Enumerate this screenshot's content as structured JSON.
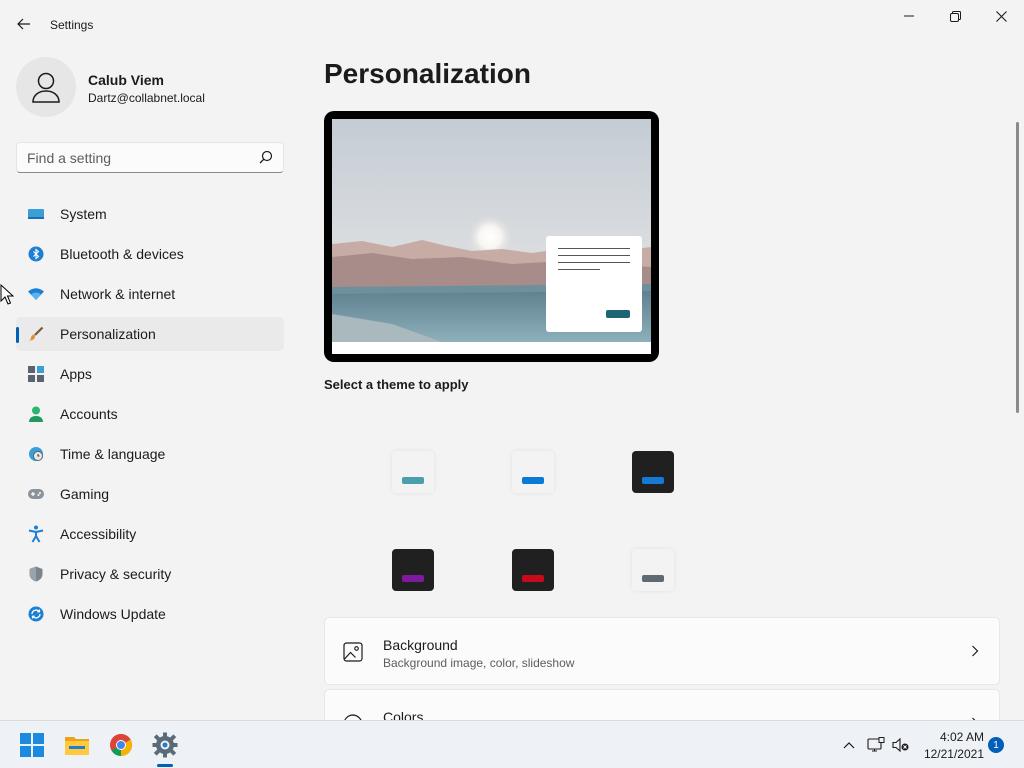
{
  "window": {
    "title": "Settings"
  },
  "user": {
    "name": "Calub Viem",
    "email": "Dartz@collabnet.local"
  },
  "search": {
    "placeholder": "Find a setting"
  },
  "nav": {
    "items": [
      {
        "label": "System",
        "icon": "monitor-icon",
        "active": false
      },
      {
        "label": "Bluetooth & devices",
        "icon": "bluetooth-icon",
        "active": false
      },
      {
        "label": "Network & internet",
        "icon": "wifi-icon",
        "active": false
      },
      {
        "label": "Personalization",
        "icon": "brush-icon",
        "active": true
      },
      {
        "label": "Apps",
        "icon": "apps-icon",
        "active": false
      },
      {
        "label": "Accounts",
        "icon": "person-icon",
        "active": false
      },
      {
        "label": "Time & language",
        "icon": "globe-clock-icon",
        "active": false
      },
      {
        "label": "Gaming",
        "icon": "gamepad-icon",
        "active": false
      },
      {
        "label": "Accessibility",
        "icon": "accessibility-icon",
        "active": false
      },
      {
        "label": "Privacy & security",
        "icon": "shield-icon",
        "active": false
      },
      {
        "label": "Windows Update",
        "icon": "update-icon",
        "active": false
      }
    ]
  },
  "main": {
    "title": "Personalization",
    "theme_heading": "Select a theme to apply",
    "themes": [
      {
        "name": "light-teal",
        "bg": "#f3f3f3",
        "accent": "#4b9fab"
      },
      {
        "name": "light-blue",
        "bg": "#f3f3f3",
        "accent": "#0a7ad4"
      },
      {
        "name": "dark-blue",
        "bg": "#202020",
        "accent": "#1679d2"
      },
      {
        "name": "dark-purple",
        "bg": "#202020",
        "accent": "#7d1a9e"
      },
      {
        "name": "dark-red",
        "bg": "#202020",
        "accent": "#c50a1c"
      },
      {
        "name": "light-gray",
        "bg": "#f3f3f3",
        "accent": "#5e6b73"
      }
    ],
    "cards": [
      {
        "title": "Background",
        "subtitle": "Background image, color, slideshow",
        "icon": "image-icon"
      },
      {
        "title": "Colors",
        "subtitle": "",
        "icon": "palette-icon"
      }
    ]
  },
  "taskbar": {
    "apps": [
      "start-icon",
      "file-explorer-icon",
      "chrome-icon",
      "settings-icon"
    ],
    "time": "4:02 AM",
    "date": "12/21/2021",
    "notification_count": "1"
  },
  "colors": {
    "accent": "#005fb8",
    "background": "#f3f3f3"
  }
}
